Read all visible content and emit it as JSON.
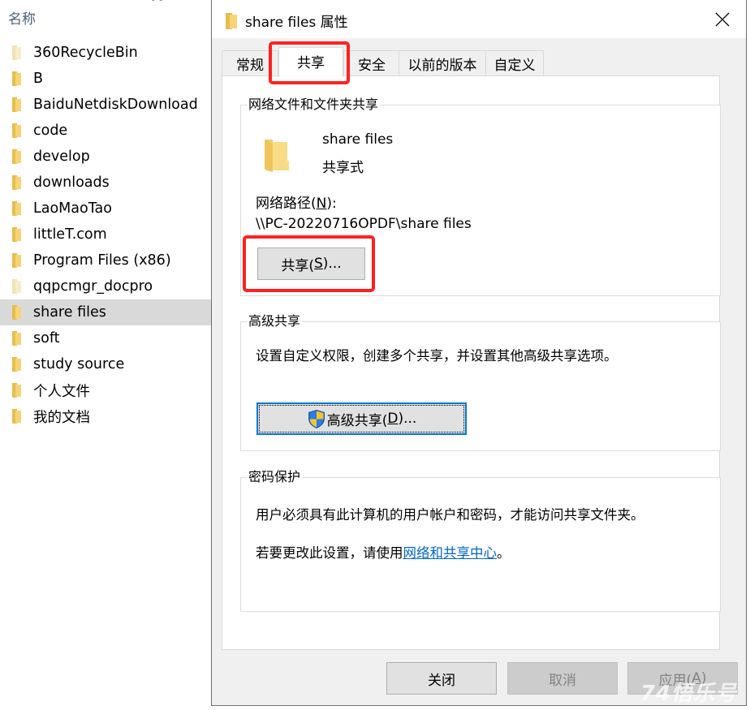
{
  "explorer": {
    "column_header": "名称",
    "sort_indicator": "ascending",
    "items": [
      {
        "name": "360RecycleBin",
        "faded": true,
        "selected": false
      },
      {
        "name": "B",
        "faded": false,
        "selected": false
      },
      {
        "name": "BaiduNetdiskDownload",
        "faded": false,
        "selected": false
      },
      {
        "name": "code",
        "faded": false,
        "selected": false
      },
      {
        "name": "develop",
        "faded": false,
        "selected": false
      },
      {
        "name": "downloads",
        "faded": false,
        "selected": false
      },
      {
        "name": "LaoMaoTao",
        "faded": false,
        "selected": false
      },
      {
        "name": "littleT.com",
        "faded": false,
        "selected": false
      },
      {
        "name": "Program Files (x86)",
        "faded": false,
        "selected": false
      },
      {
        "name": "qqpcmgr_docpro",
        "faded": true,
        "selected": false
      },
      {
        "name": "share files",
        "faded": false,
        "selected": true
      },
      {
        "name": "soft",
        "faded": false,
        "selected": false
      },
      {
        "name": "study source",
        "faded": false,
        "selected": false
      },
      {
        "name": "个人文件",
        "faded": false,
        "selected": false
      },
      {
        "name": "我的文档",
        "faded": false,
        "selected": false
      }
    ]
  },
  "dialog": {
    "title": "share files 属性",
    "close_icon": "close-icon",
    "tabs": [
      {
        "label": "常规",
        "active": false
      },
      {
        "label": "共享",
        "active": true
      },
      {
        "label": "安全",
        "active": false
      },
      {
        "label": "以前的版本",
        "active": false
      },
      {
        "label": "自定义",
        "active": false
      }
    ],
    "network_sharing": {
      "group_label": "网络文件和文件夹共享",
      "folder_name": "share files",
      "status": "共享式",
      "path_label": "网络路径(",
      "path_label_key": "N",
      "path_label_end": "):",
      "path_value": "\\\\PC-20220716OPDF\\share files",
      "share_button": {
        "prefix": "共享(",
        "key": "S",
        "suffix": ")..."
      }
    },
    "advanced_sharing": {
      "group_label": "高级共享",
      "description": "设置自定义权限，创建多个共享，并设置其他高级共享选项。",
      "button": {
        "prefix": "高级共享(",
        "key": "D",
        "suffix": ")...",
        "icon": "uac-shield-icon"
      }
    },
    "password_protection": {
      "group_label": "密码保护",
      "description": "用户必须具有此计算机的用户帐户和密码，才能访问共享文件夹。",
      "change_prefix": "若要更改此设置，请使用",
      "link_text": "网络和共享中心",
      "change_suffix": "。"
    },
    "footer": {
      "close_label": "关闭",
      "cancel_label": "取消",
      "apply_prefix": "应用(",
      "apply_key": "A",
      "apply_suffix": ")"
    }
  },
  "annotations": {
    "highlight_color": "#ff2020",
    "highlighted": [
      "tab-sharing",
      "share-button"
    ]
  },
  "watermark": "74悟乐号",
  "colors": {
    "accent": "#0078d7",
    "link": "#0066cc",
    "selection": "#d9d9d9",
    "folder": "#f6d475"
  }
}
